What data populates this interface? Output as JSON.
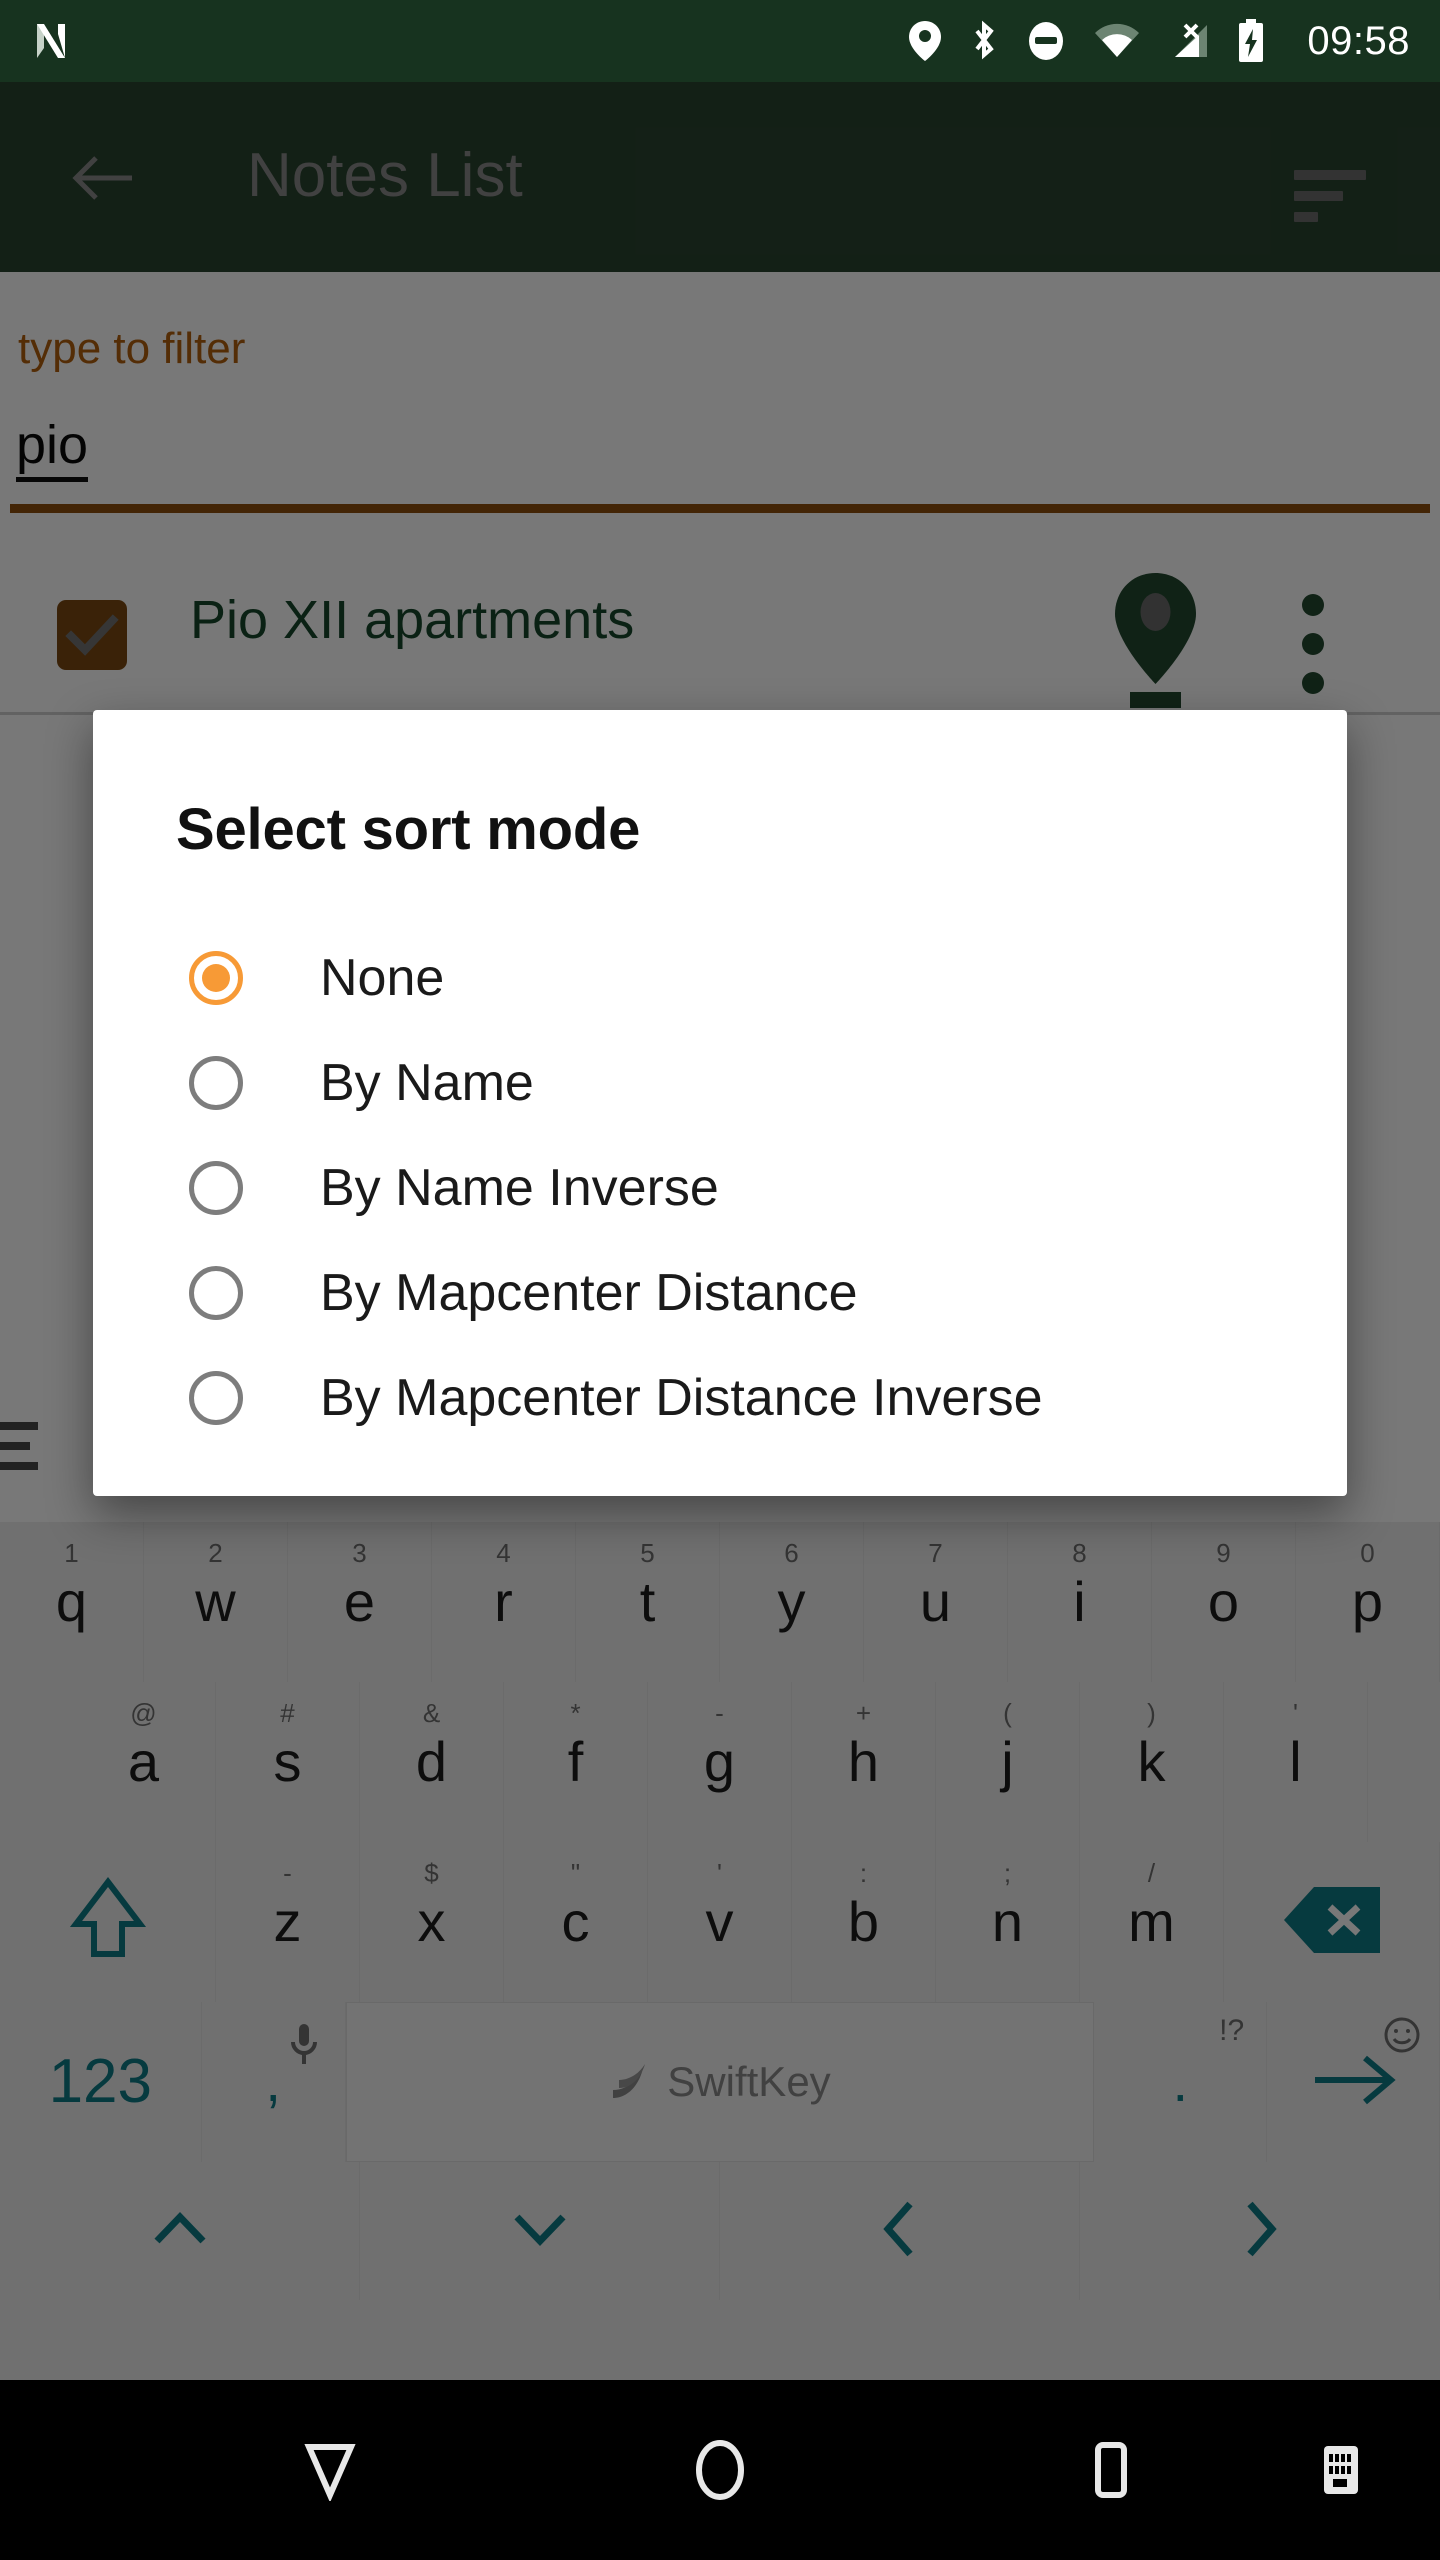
{
  "status_bar": {
    "time": "09:58",
    "icons": [
      "location-icon",
      "bluetooth-icon",
      "do-not-disturb-icon",
      "wifi-icon",
      "cellular-signal-no-sim-icon",
      "battery-charging-icon"
    ],
    "left_icon": "nexus-n-logo-icon",
    "background": "#17331f"
  },
  "app_bar": {
    "title": "Notes List",
    "back_icon": "arrow-left-icon",
    "sort_icon": "sort-icon",
    "background": "#2a4430"
  },
  "filter": {
    "label": "type to filter",
    "value": "pio",
    "placeholder": "type to filter",
    "label_color": "#b3600d",
    "underline_color": "#8e4f0d"
  },
  "list": {
    "items": [
      {
        "title": "Pio XII apartments",
        "checked": true,
        "checkbox_color": "#7b4a12",
        "title_color": "#17472b",
        "pin_icon": "map-pin-icon",
        "overflow_icon": "more-vertical-icon"
      }
    ]
  },
  "dialog": {
    "title": "Select sort mode",
    "selected_index": 0,
    "accent_color": "#f79a36",
    "options": [
      {
        "label": "None",
        "checked": true
      },
      {
        "label": "By Name",
        "checked": false
      },
      {
        "label": "By Name Inverse",
        "checked": false
      },
      {
        "label": "By Mapcenter Distance",
        "checked": false
      },
      {
        "label": "By Mapcenter Distance Inverse",
        "checked": false
      }
    ]
  },
  "keyboard": {
    "vendor": "SwiftKey",
    "accent_color": "#0d7b86",
    "row1": [
      {
        "key": "q",
        "sup": "1"
      },
      {
        "key": "w",
        "sup": "2"
      },
      {
        "key": "e",
        "sup": "3"
      },
      {
        "key": "r",
        "sup": "4"
      },
      {
        "key": "t",
        "sup": "5"
      },
      {
        "key": "y",
        "sup": "6"
      },
      {
        "key": "u",
        "sup": "7"
      },
      {
        "key": "i",
        "sup": "8"
      },
      {
        "key": "o",
        "sup": "9"
      },
      {
        "key": "p",
        "sup": "0"
      }
    ],
    "row2": [
      {
        "key": "a",
        "sup": "@"
      },
      {
        "key": "s",
        "sup": "#"
      },
      {
        "key": "d",
        "sup": "&"
      },
      {
        "key": "f",
        "sup": "*"
      },
      {
        "key": "g",
        "sup": "-"
      },
      {
        "key": "h",
        "sup": "+"
      },
      {
        "key": "j",
        "sup": "("
      },
      {
        "key": "k",
        "sup": ")"
      },
      {
        "key": "l",
        "sup": "'"
      }
    ],
    "row3": [
      {
        "key": "z",
        "sup": "-"
      },
      {
        "key": "x",
        "sup": "$"
      },
      {
        "key": "c",
        "sup": "\""
      },
      {
        "key": "v",
        "sup": "'"
      },
      {
        "key": "b",
        "sup": ":"
      },
      {
        "key": "n",
        "sup": ";"
      },
      {
        "key": "m",
        "sup": "/"
      }
    ],
    "shift_key": "shift-key",
    "backspace_key": "backspace-key",
    "numbers_key": "123",
    "comma_key": ",",
    "mic_key": "microphone-icon",
    "period_key": ".",
    "punctuation_key": "!?",
    "emoji_key": "emoji-icon",
    "enter_key": "enter-key",
    "nav_keys": [
      "arrow-up-icon",
      "arrow-down-icon",
      "arrow-left-icon",
      "arrow-right-icon"
    ]
  },
  "nav_bar": {
    "back": "back-triangle-icon",
    "home": "home-circle-icon",
    "recents": "recents-square-icon",
    "keyboard_toggle": "keyboard-icon"
  }
}
